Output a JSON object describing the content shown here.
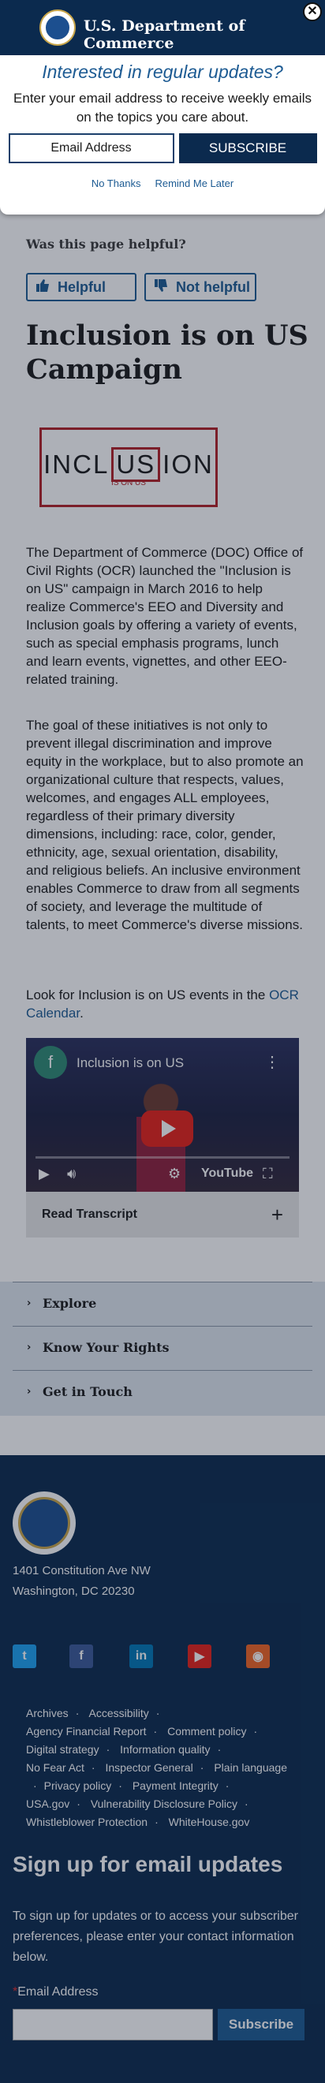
{
  "header": {
    "title": "U.S. Department of Commerce",
    "close_label": "✕"
  },
  "signup_modal": {
    "heading": "Interested in regular updates?",
    "subtext": "Enter your email address to receive weekly emails on the topics you care about.",
    "email_placeholder": "Email Address",
    "subscribe_label": "SUBSCRIBE",
    "no_thanks": "No Thanks",
    "remind_later": "Remind Me Later"
  },
  "feedback": {
    "question": "Was this page helpful?",
    "yes_label": "Helpful",
    "no_label": "Not helpful"
  },
  "page": {
    "title": "Inclusion is on US Campaign",
    "logo": {
      "part1": "INCL",
      "part2": "US",
      "part3": "ION",
      "tagline": "IS ON US"
    },
    "paragraph1": "The Department of Commerce (DOC) Office of Civil Rights (OCR) launched the \"Inclusion is on US\" campaign in March 2016 to help realize Commerce's EEO and Diversity and Inclusion goals by offering a variety of events, such as special emphasis programs, lunch and learn events, vignettes, and other EEO-related training.",
    "paragraph2": "The goal of these initiatives is not only to prevent illegal discrimination and improve equity in the workplace, but to also promote an organizational culture that respects, values, welcomes, and engages ALL employees, regardless of their primary diversity dimensions, including: race, color, gender, ethnicity, age, sexual orientation, disability, and religious beliefs. An inclusive environment enables Commerce to draw from all segments of society, and leverage the multitude of talents, to meet Commerce's diverse missions.",
    "paragraph3_prefix": "Look for Inclusion is on US events in the ",
    "paragraph3_link": "OCR Calendar",
    "paragraph3_suffix": "."
  },
  "video": {
    "channel_initial": "f",
    "title": "Inclusion is on US",
    "youtube_label": "YouTube"
  },
  "transcript": {
    "label": "Read Transcript",
    "toggle": "+"
  },
  "accordions": [
    {
      "label": "Explore"
    },
    {
      "label": "Know Your Rights"
    },
    {
      "label": "Get in Touch"
    }
  ],
  "footer": {
    "address_line1": "1401 Constitution Ave NW",
    "address_line2": "Washington, DC 20230",
    "social": [
      {
        "icon": "twitter-icon",
        "glyph": "t",
        "color": "#1da1f2"
      },
      {
        "icon": "facebook-icon",
        "glyph": "f",
        "color": "#3b5998"
      },
      {
        "icon": "linkedin-icon",
        "glyph": "in",
        "color": "#0077b5"
      },
      {
        "icon": "youtube-icon",
        "glyph": "▶",
        "color": "#e62117"
      },
      {
        "icon": "rss-icon",
        "glyph": "◉",
        "color": "#f26522"
      }
    ],
    "links": [
      "Archives",
      "Accessibility",
      "Agency Financial Report",
      "Comment policy",
      "Digital strategy",
      "Information quality",
      "No Fear Act",
      "Inspector General",
      "Plain language",
      "Privacy policy",
      "Payment Integrity",
      "USA.gov",
      "Vulnerability Disclosure Policy",
      "Whistleblower Protection",
      "WhiteHouse.gov"
    ],
    "signup_heading": "Sign up for email updates",
    "signup_text": "To sign up for updates or to access your subscriber preferences, please enter your contact information below.",
    "email_label_req": "*",
    "email_label": "Email Address",
    "subscribe_label": "Subscribe"
  },
  "colors": {
    "navy": "#0b2a4e",
    "link_blue": "#1d5b93",
    "logo_red": "#b22026"
  }
}
